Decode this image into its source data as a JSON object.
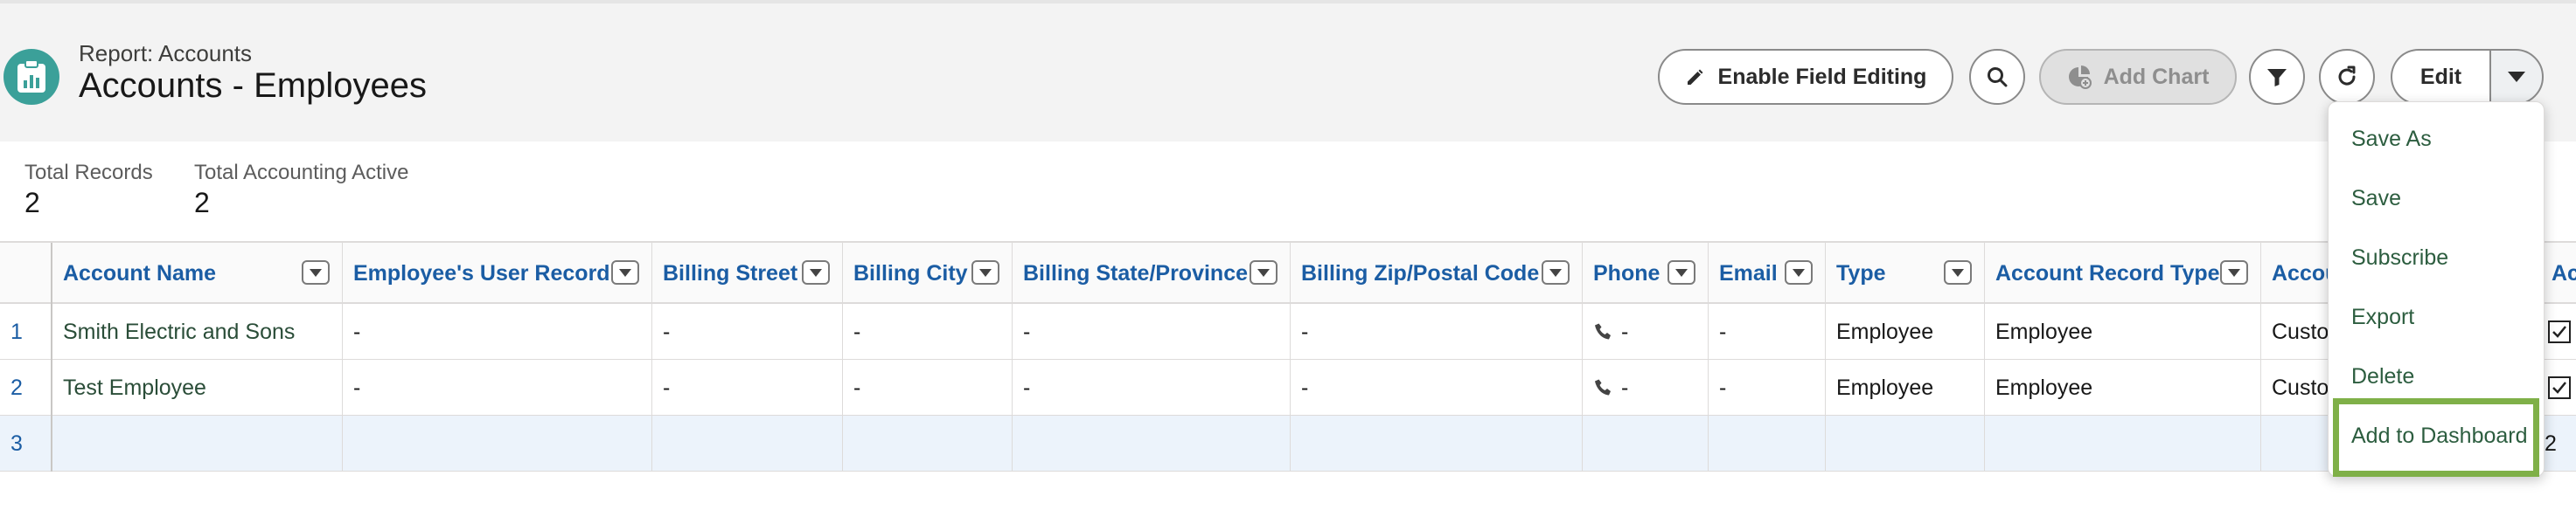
{
  "header": {
    "subtitle": "Report: Accounts",
    "title": "Accounts - Employees",
    "buttons": {
      "enable_field_editing": "Enable Field Editing",
      "add_chart": "Add Chart",
      "edit": "Edit"
    },
    "icons": {
      "report": "report-icon",
      "search": "search-icon",
      "filter": "filter-icon",
      "refresh": "refresh-icon",
      "pencil": "pencil-icon",
      "chart": "chart-icon",
      "dropdown": "chevron-down-icon"
    }
  },
  "summary": [
    {
      "label": "Total Records",
      "value": "2"
    },
    {
      "label": "Total Accounting Active",
      "value": "2"
    }
  ],
  "table": {
    "columns": [
      "Account Name",
      "Employee's User Record",
      "Billing Street",
      "Billing City",
      "Billing State/Province",
      "Billing Zip/Postal Code",
      "Phone",
      "Email",
      "Type",
      "Account Record Type",
      "Accou",
      "Ac"
    ],
    "rows": [
      {
        "num": "1",
        "cells": [
          "Smith Electric and Sons",
          "-",
          "-",
          "-",
          "-",
          "-",
          "-",
          "-",
          "Employee",
          "Employee",
          "Custo",
          ""
        ]
      },
      {
        "num": "2",
        "cells": [
          "Test Employee",
          "-",
          "-",
          "-",
          "-",
          "-",
          "-",
          "-",
          "Employee",
          "Employee",
          "Custo",
          ""
        ]
      },
      {
        "num": "3",
        "cells": [
          "",
          "",
          "",
          "",
          "",
          "",
          "",
          "",
          "",
          "",
          "",
          "2"
        ]
      }
    ]
  },
  "menu": {
    "items": [
      "Save As",
      "Save",
      "Subscribe",
      "Export",
      "Delete",
      "Add to Dashboard"
    ],
    "highlighted": "Add to Dashboard",
    "highlight_color": "#7fb048"
  },
  "colors": {
    "header_bg": "#f3f3f3",
    "link_blue": "#1b5da4",
    "menu_text": "#2c5d3f",
    "icon_teal": "#3ba099"
  }
}
